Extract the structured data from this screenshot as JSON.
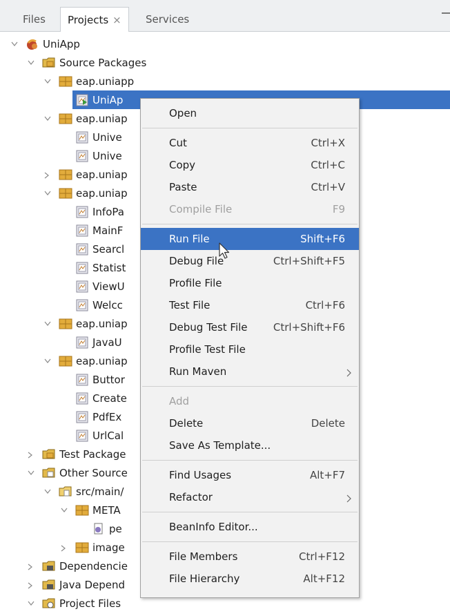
{
  "tabs": [
    {
      "label": "Files"
    },
    {
      "label": "Projects",
      "close": "×"
    },
    {
      "label": "Services"
    }
  ],
  "tree": [
    {
      "label": "UniApp",
      "icon": "project-icon",
      "expanded": true
    },
    {
      "label": "Source Packages",
      "icon": "source-packages-icon",
      "expanded": true
    },
    {
      "label": "eap.uniapp",
      "icon": "package-icon",
      "expanded": true
    },
    {
      "label": "UniAp",
      "icon": "java-main-class-icon",
      "selected": true
    },
    {
      "label": "eap.uniap",
      "icon": "package-icon",
      "expanded": true
    },
    {
      "label": "Unive",
      "icon": "java-class-icon"
    },
    {
      "label": "Unive",
      "icon": "java-class-icon"
    },
    {
      "label": "eap.uniap",
      "icon": "package-icon",
      "expanded": false
    },
    {
      "label": "eap.uniap",
      "icon": "package-icon",
      "expanded": true
    },
    {
      "label": "InfoPa",
      "icon": "java-class-icon"
    },
    {
      "label": "MainF",
      "icon": "java-class-icon"
    },
    {
      "label": "Searcl",
      "icon": "java-class-icon"
    },
    {
      "label": "Statist",
      "icon": "java-class-icon"
    },
    {
      "label": "ViewU",
      "icon": "java-class-icon"
    },
    {
      "label": "Welcc",
      "icon": "java-class-icon"
    },
    {
      "label": "eap.uniap",
      "icon": "package-icon",
      "expanded": true
    },
    {
      "label": "JavaU",
      "icon": "java-class-icon"
    },
    {
      "label": "eap.uniap",
      "icon": "package-icon",
      "expanded": true
    },
    {
      "label": "Buttor",
      "icon": "java-class-icon"
    },
    {
      "label": "Create",
      "icon": "java-class-icon"
    },
    {
      "label": "PdfEx",
      "icon": "java-class-icon"
    },
    {
      "label": "UrlCal",
      "icon": "java-class-icon"
    },
    {
      "label": "Test Package",
      "icon": "test-packages-icon",
      "expanded": false
    },
    {
      "label": "Other Source",
      "icon": "other-sources-icon",
      "expanded": true
    },
    {
      "label": "src/main/",
      "icon": "folder-icon",
      "expanded": true
    },
    {
      "label": "META",
      "icon": "package-icon",
      "expanded": true
    },
    {
      "label": "pe",
      "icon": "properties-file-icon"
    },
    {
      "label": "image",
      "icon": "package-icon",
      "expanded": false
    },
    {
      "label": "Dependencie",
      "icon": "dependencies-icon",
      "expanded": false
    },
    {
      "label": "Java Depend",
      "icon": "java-dependencies-icon",
      "expanded": false
    },
    {
      "label": "Project Files",
      "icon": "project-files-icon",
      "expanded": true
    }
  ],
  "menu": {
    "items": [
      {
        "label": "Open",
        "shortcut": ""
      },
      {
        "separator": true
      },
      {
        "label": "Cut",
        "shortcut": "Ctrl+X"
      },
      {
        "label": "Copy",
        "shortcut": "Ctrl+C"
      },
      {
        "label": "Paste",
        "shortcut": "Ctrl+V"
      },
      {
        "label": "Compile File",
        "shortcut": "F9",
        "disabled": true
      },
      {
        "separator": true
      },
      {
        "label": "Run File",
        "shortcut": "Shift+F6",
        "highlighted": true
      },
      {
        "label": "Debug File",
        "shortcut": "Ctrl+Shift+F5"
      },
      {
        "label": "Profile File",
        "shortcut": ""
      },
      {
        "label": "Test File",
        "shortcut": "Ctrl+F6"
      },
      {
        "label": "Debug Test File",
        "shortcut": "Ctrl+Shift+F6"
      },
      {
        "label": "Profile Test File",
        "shortcut": ""
      },
      {
        "label": "Run Maven",
        "shortcut": "",
        "submenu": true
      },
      {
        "separator": true
      },
      {
        "label": "Add",
        "shortcut": "",
        "disabled": true
      },
      {
        "label": "Delete",
        "shortcut": "Delete"
      },
      {
        "label": "Save As Template...",
        "shortcut": ""
      },
      {
        "separator": true
      },
      {
        "label": "Find Usages",
        "shortcut": "Alt+F7"
      },
      {
        "label": "Refactor",
        "shortcut": "",
        "submenu": true
      },
      {
        "separator": true
      },
      {
        "label": "BeanInfo Editor...",
        "shortcut": ""
      },
      {
        "separator": true
      },
      {
        "label": "File Members",
        "shortcut": "Ctrl+F12"
      },
      {
        "label": "File Hierarchy",
        "shortcut": "Alt+F12"
      }
    ]
  },
  "colors": {
    "selection": "#3b73c4",
    "package": "#d9a230",
    "menu_bg": "#f2f2f2"
  }
}
